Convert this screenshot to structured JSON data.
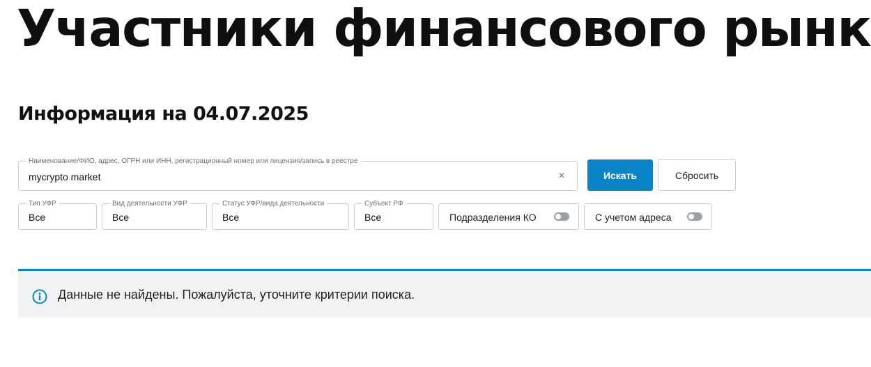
{
  "page": {
    "title": "Участники финансового рынка",
    "info_date": "Информация на 04.07.2025"
  },
  "search": {
    "legend": "Наименование/ФИО, адрес, ОГРН или ИНН, регистрационный номер или лицензия/запись в реестре",
    "value": "mycrypto market",
    "clear_icon": "close-icon",
    "clear_symbol": "×",
    "search_button": "Искать",
    "reset_button": "Сбросить"
  },
  "filters": {
    "type": {
      "legend": "Тип УФР",
      "value": "Все"
    },
    "activity": {
      "legend": "Вид деятельности УФР",
      "value": "Все"
    },
    "status": {
      "legend": "Статус УФР/вида деятельности",
      "value": "Все"
    },
    "region": {
      "legend": "Субъект РФ",
      "value": "Все"
    },
    "toggle_branches": {
      "label": "Подразделения КО",
      "enabled": false
    },
    "toggle_address": {
      "label": "С учетом адреса",
      "enabled": false
    }
  },
  "notice": {
    "icon": "info-icon",
    "text": "Данные не найдены. Пожалуйста, уточните критерии поиска."
  },
  "colors": {
    "accent": "#0a84c6",
    "notice_bg": "#f1f2f4",
    "toggle_off": "#9aa0a6"
  }
}
